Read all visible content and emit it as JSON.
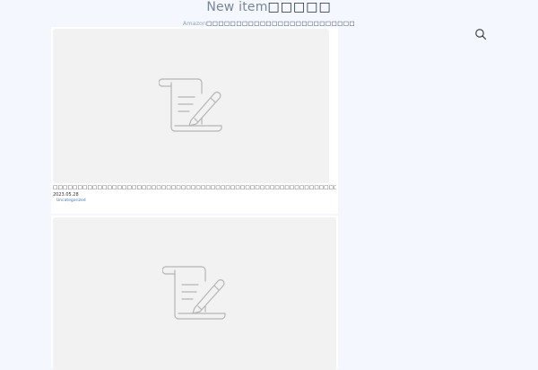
{
  "header": {
    "site_title": "New item",
    "site_title_boxes": "□□□□□",
    "tagline": "Amazon",
    "tagline_boxes": "□□□□□□□□□□□□□□□□□□□□□□□□□"
  },
  "search": {
    "icon": "search-icon"
  },
  "posts": [
    {
      "thumbnail_icon": "document-pen-icon",
      "title": "□□□□□□□□□□□□□□□□□□□□□□□□□□□□□□□□□□□□□□□□□□□□□□□□□□□□□□□□□□□□□□□□",
      "date": "2023.05.28",
      "category": "Uncategorized"
    },
    {
      "thumbnail_icon": "document-pen-icon"
    }
  ],
  "colors": {
    "background": "#f4f8fe",
    "card": "#ffffff",
    "thumbnail": "#f2f2f2",
    "category_link": "#3a78c2"
  }
}
